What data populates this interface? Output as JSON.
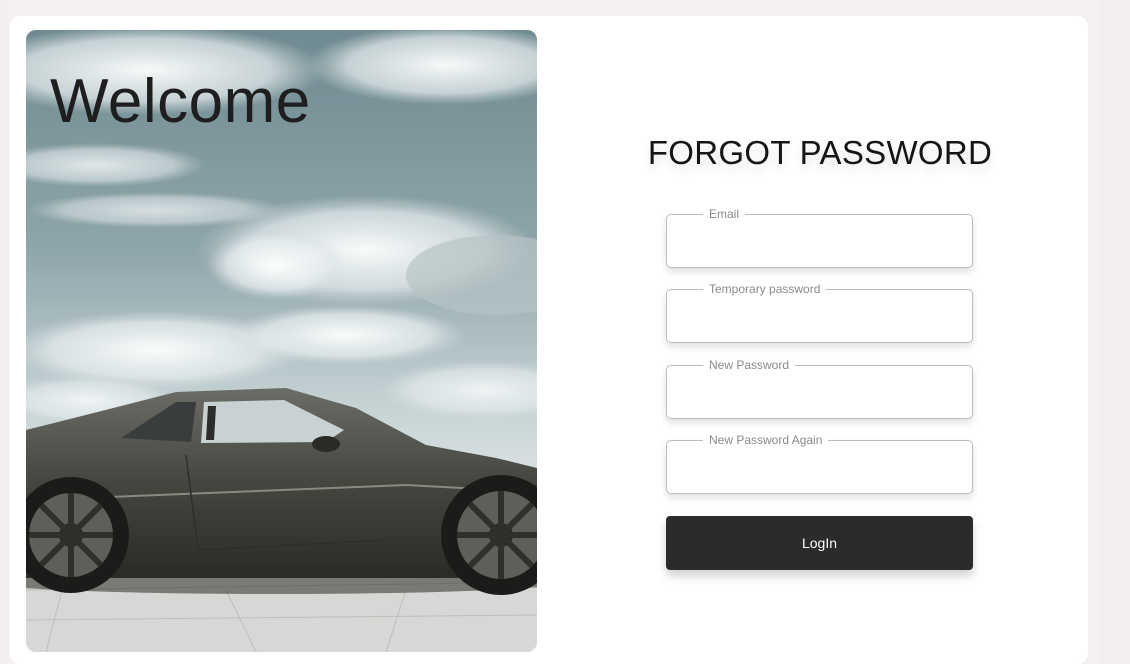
{
  "hero": {
    "welcome_text": "Welcome",
    "image_subject": "car-under-cloudy-sky-image"
  },
  "form": {
    "title": "FORGOT PASSWORD",
    "fields": [
      {
        "label": "Email",
        "value": ""
      },
      {
        "label": "Temporary password",
        "value": ""
      },
      {
        "label": "New Password",
        "value": ""
      },
      {
        "label": "New Password Again",
        "value": ""
      }
    ],
    "submit_label": "LogIn"
  },
  "colors": {
    "background": "#f4f0ef",
    "card": "#ffffff",
    "button": "#2b2b2b",
    "button_text": "#ffffff",
    "field_border": "#bdbdbd"
  }
}
